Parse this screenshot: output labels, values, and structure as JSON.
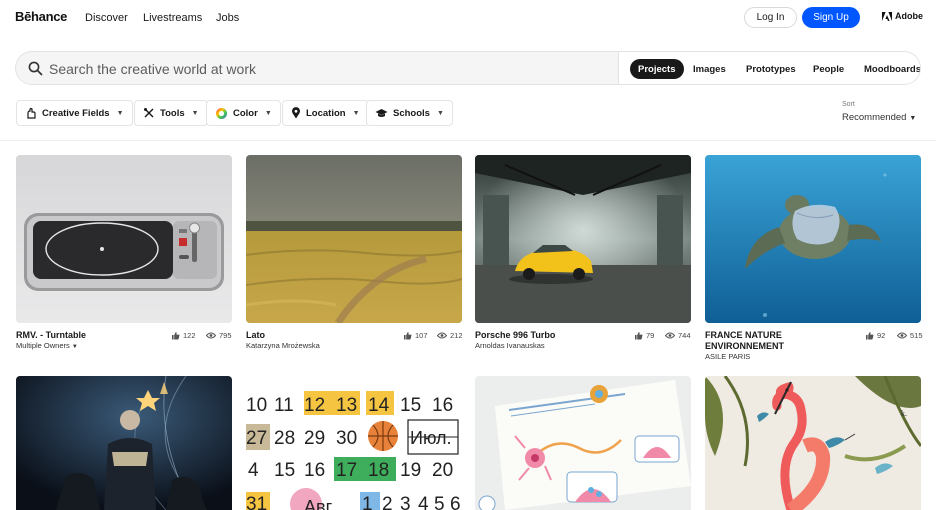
{
  "nav": {
    "logo": "Bēhance",
    "links": [
      "Discover",
      "Livestreams",
      "Jobs"
    ],
    "login": "Log In",
    "signup": "Sign Up",
    "adobe": "Adobe",
    "signup_color": "#0057ff"
  },
  "search": {
    "placeholder": "Search the creative world at work",
    "types": [
      "Projects",
      "Images",
      "Prototypes",
      "People",
      "Moodboards"
    ],
    "active_type": "Projects"
  },
  "filters": [
    {
      "label": "Creative Fields",
      "icon": "creative-fields-icon"
    },
    {
      "label": "Tools",
      "icon": "tools-icon"
    },
    {
      "label": "Color",
      "icon": "color-wheel-icon"
    },
    {
      "label": "Location",
      "icon": "location-pin-icon"
    },
    {
      "label": "Schools",
      "icon": "graduation-cap-icon"
    }
  ],
  "sort": {
    "label": "Sort",
    "value": "Recommended"
  },
  "projects": [
    {
      "title": "RMV. - Turntable",
      "owner": "Multiple Owners",
      "owner_dropdown": true,
      "likes": "122",
      "views": "795",
      "image": "turntable"
    },
    {
      "title": "Lato",
      "owner": "Katarzyna Mrożewska",
      "likes": "107",
      "views": "212",
      "image": "wheat-field"
    },
    {
      "title": "Porsche 996 Turbo",
      "owner": "Arnoldas Ivanauskas",
      "likes": "79",
      "views": "744",
      "image": "yellow-car-warehouse"
    },
    {
      "title": "FRANCE NATURE ENVIRONNEMENT",
      "owner": "ASILE PARIS",
      "likes": "92",
      "views": "515",
      "image": "sea-turtle-bag"
    },
    {
      "image": "astronaut-poster"
    },
    {
      "image": "calendar-numbers",
      "calendar_text": [
        "10",
        "11",
        "12",
        "13",
        "14",
        "15",
        "16",
        "27",
        "28",
        "29",
        "30",
        "Июл.",
        "4",
        "15",
        "16",
        "17",
        "18",
        "19",
        "20",
        "31",
        "Авг",
        "1",
        "2",
        "3",
        "4",
        "5",
        "6"
      ]
    },
    {
      "image": "neuron-diagram"
    },
    {
      "image": "flamingo-illustration"
    }
  ]
}
